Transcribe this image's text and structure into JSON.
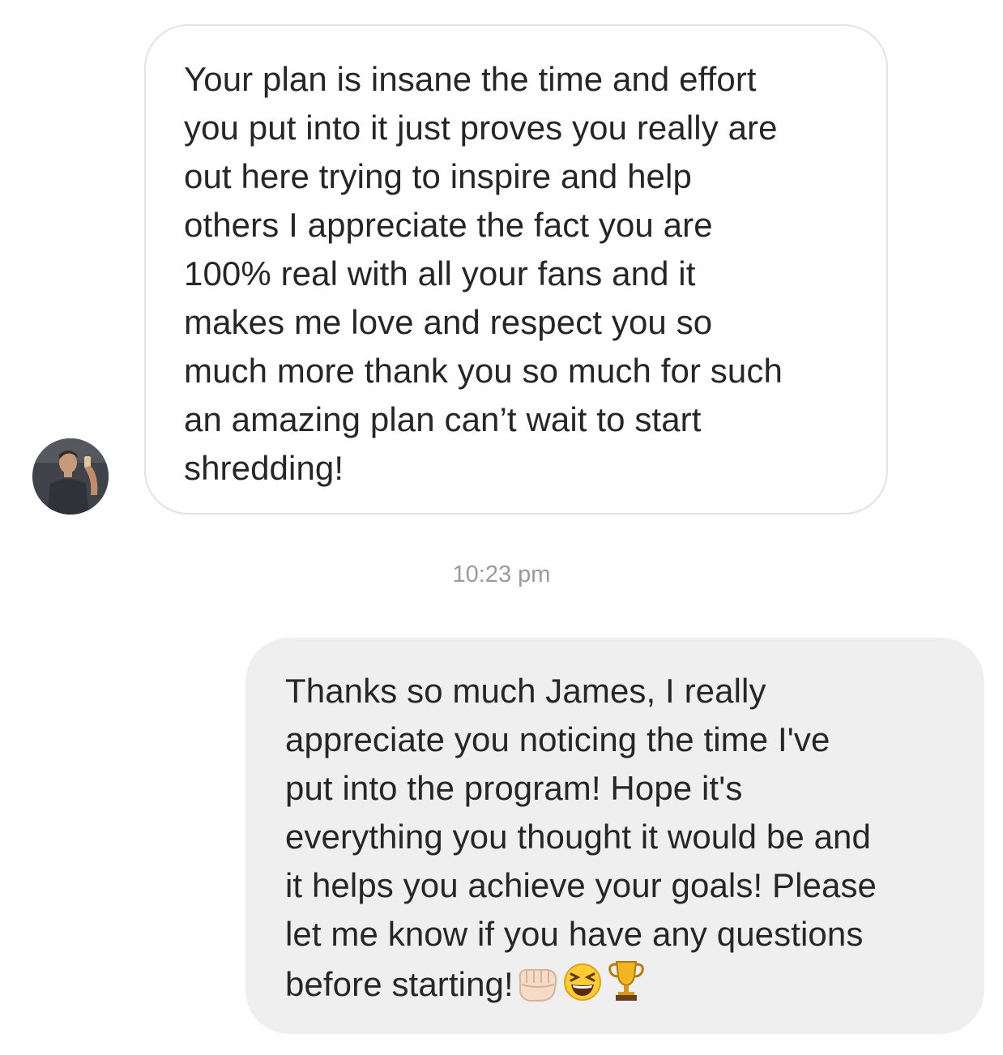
{
  "thread": {
    "incoming": {
      "avatar_icon": "user-avatar",
      "text": "Your plan is insane the time and effort\nyou put into it just proves you really are\nout here trying to inspire and help\nothers I appreciate the fact you are\n100% real with all your fans and it\nmakes me love and respect you so\nmuch more thank you so much for such\nan amazing plan can’t wait to start\nshredding!"
    },
    "timestamp": "10:23 pm",
    "outgoing": {
      "text": "Thanks so much James, I really\nappreciate you noticing the time I've\nput into the program! Hope it's\neverything you thought it would be and\nit helps you achieve your goals! Please\nlet me know if you have any questions\nbefore starting!",
      "emojis": [
        "fist-bump-emoji",
        "grinning-squinting-face-emoji",
        "trophy-emoji"
      ]
    }
  },
  "colors": {
    "incoming_bubble_border": "#e2e2e2",
    "outgoing_bubble_bg": "#efefef",
    "text": "#262626",
    "timestamp": "#9a9a9a"
  }
}
